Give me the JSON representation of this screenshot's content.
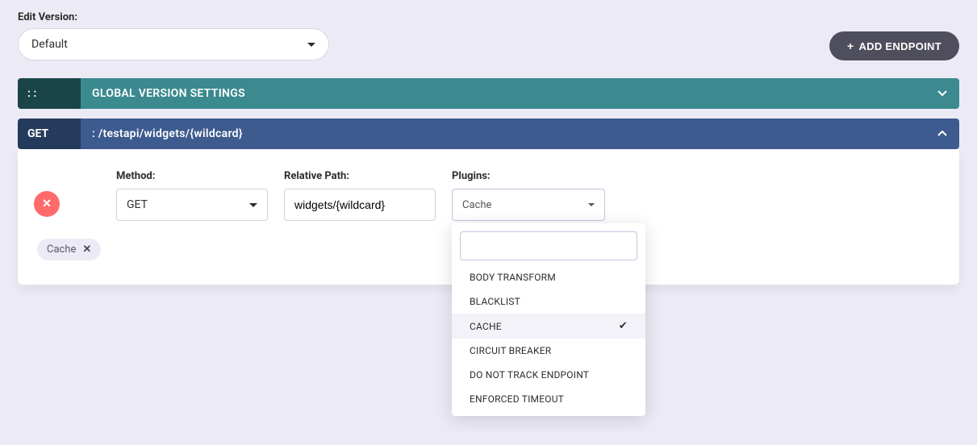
{
  "topbar": {
    "edit_version_label": "Edit Version:",
    "selected_version": "Default",
    "add_endpoint_label": "ADD ENDPOINT"
  },
  "global_settings": {
    "left_label": ": :",
    "title": "GLOBAL VERSION SETTINGS"
  },
  "endpoint_header": {
    "method": "GET",
    "path": ": /testapi/widgets/{wildcard}"
  },
  "endpoint_form": {
    "method_label": "Method:",
    "method_value": "GET",
    "path_label": "Relative Path:",
    "path_value": "widgets/{wildcard}",
    "plugins_label": "Plugins:",
    "plugins_selected": "Cache"
  },
  "tags": [
    {
      "label": "Cache"
    }
  ],
  "plugins_dropdown": {
    "search_value": "",
    "options": [
      {
        "label": "BODY TRANSFORM",
        "selected": false
      },
      {
        "label": "BLACKLIST",
        "selected": false
      },
      {
        "label": "CACHE",
        "selected": true
      },
      {
        "label": "CIRCUIT BREAKER",
        "selected": false
      },
      {
        "label": "DO NOT TRACK ENDPOINT",
        "selected": false
      },
      {
        "label": "ENFORCED TIMEOUT",
        "selected": false
      }
    ]
  }
}
